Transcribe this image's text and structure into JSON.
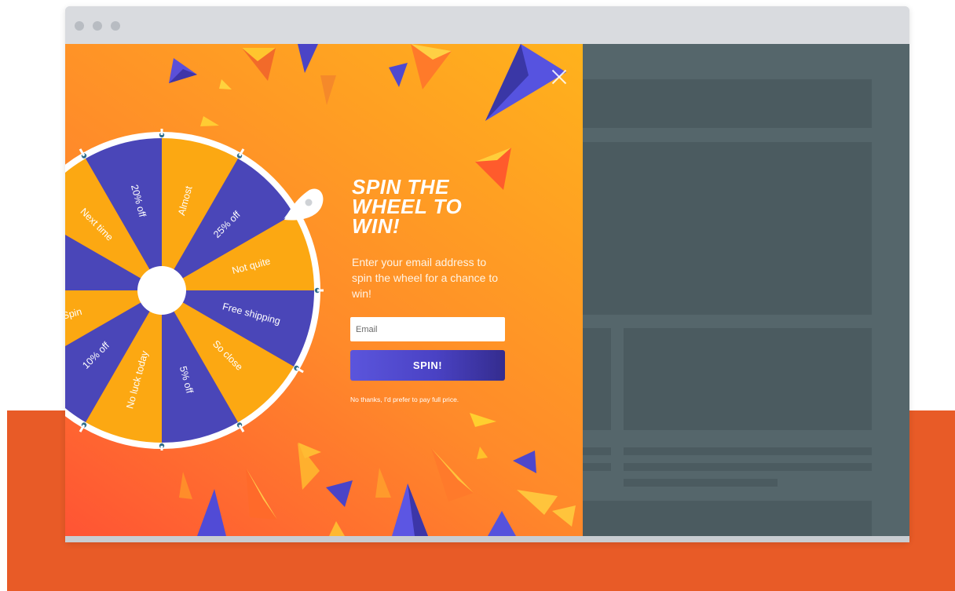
{
  "popup": {
    "headline_line1": "SPIN THE",
    "headline_line2": "WHEEL TO",
    "headline_line3": "WIN!",
    "subtext": "Enter your email address to spin the wheel for a chance to win!",
    "email_placeholder": "Email",
    "spin_button_label": "SPIN!",
    "decline_link_label": "No thanks, I'd prefer to pay full price.",
    "close_icon": "close-icon"
  },
  "wheel": {
    "segments": [
      "Almost",
      "25% off",
      "Not quite",
      "Free shipping",
      "So close",
      "5% off",
      "No luck today",
      "10% off",
      "Spin",
      "",
      "Next time",
      "20% off"
    ]
  },
  "colors": {
    "accent_band": "#e85b27",
    "wheel_orange": "#fca812",
    "wheel_purple": "#4a46b8",
    "spin_button": "#4a42c4",
    "site_background": "#55666b"
  }
}
